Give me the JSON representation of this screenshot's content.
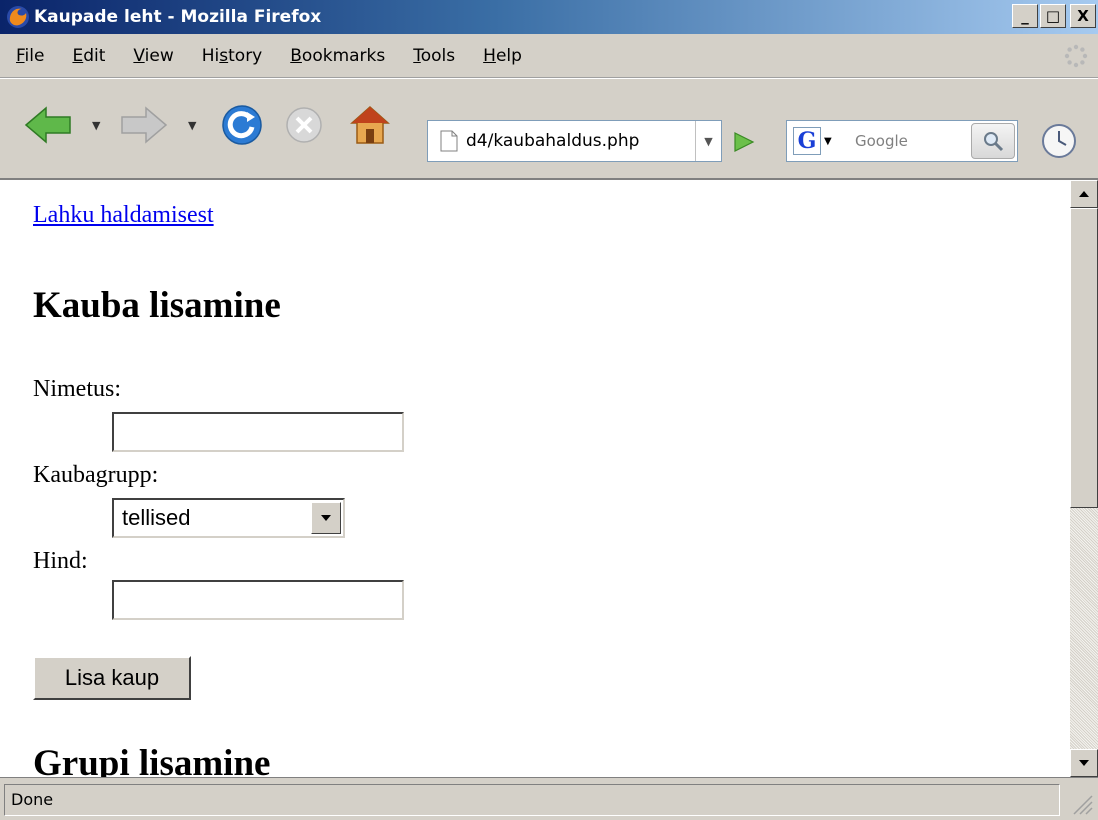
{
  "window": {
    "title": "Kaupade leht - Mozilla Firefox",
    "minimize": "_",
    "maximize": "□",
    "close": "X"
  },
  "menu": [
    {
      "label": "File"
    },
    {
      "label": "Edit"
    },
    {
      "label": "View"
    },
    {
      "label": "History"
    },
    {
      "label": "Bookmarks"
    },
    {
      "label": "Tools"
    },
    {
      "label": "Help"
    }
  ],
  "toolbar": {
    "url": "d4/kaubahaldus.php",
    "search_placeholder": "Google",
    "search_engine_letter": "G"
  },
  "page": {
    "exit_link": "Lahku haldamisest",
    "heading_add_product": "Kauba lisamine",
    "label_name": "Nimetus:",
    "label_group": "Kaubagrupp:",
    "group_selected": "tellised",
    "label_price": "Hind:",
    "submit_label": "Lisa kaup",
    "heading_add_group": "Grupi lisamine"
  },
  "status": {
    "text": "Done"
  },
  "colors": {
    "link": "#0000ee",
    "chrome": "#d4d0c8",
    "titlebar_start": "#0a246a",
    "titlebar_end": "#a6caf0"
  }
}
